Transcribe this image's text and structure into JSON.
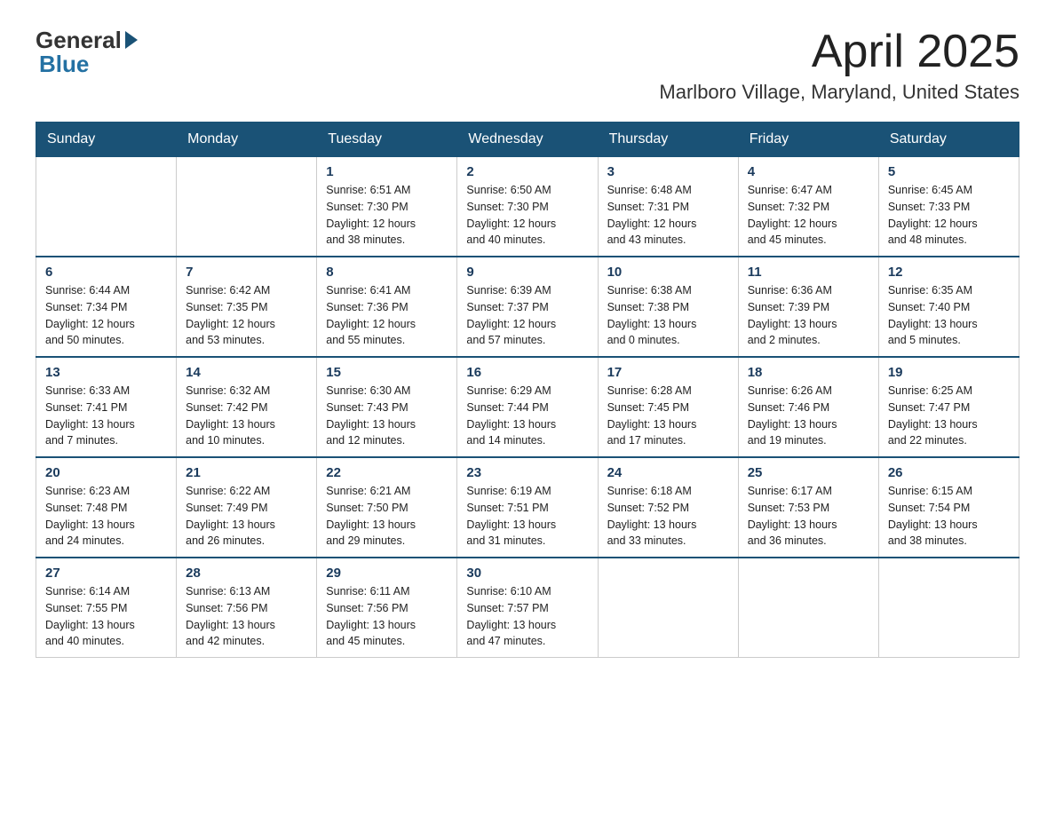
{
  "header": {
    "logo_general": "General",
    "logo_blue": "Blue",
    "month_year": "April 2025",
    "location": "Marlboro Village, Maryland, United States"
  },
  "weekdays": [
    "Sunday",
    "Monday",
    "Tuesday",
    "Wednesday",
    "Thursday",
    "Friday",
    "Saturday"
  ],
  "weeks": [
    [
      {
        "day": "",
        "info": ""
      },
      {
        "day": "",
        "info": ""
      },
      {
        "day": "1",
        "info": "Sunrise: 6:51 AM\nSunset: 7:30 PM\nDaylight: 12 hours\nand 38 minutes."
      },
      {
        "day": "2",
        "info": "Sunrise: 6:50 AM\nSunset: 7:30 PM\nDaylight: 12 hours\nand 40 minutes."
      },
      {
        "day": "3",
        "info": "Sunrise: 6:48 AM\nSunset: 7:31 PM\nDaylight: 12 hours\nand 43 minutes."
      },
      {
        "day": "4",
        "info": "Sunrise: 6:47 AM\nSunset: 7:32 PM\nDaylight: 12 hours\nand 45 minutes."
      },
      {
        "day": "5",
        "info": "Sunrise: 6:45 AM\nSunset: 7:33 PM\nDaylight: 12 hours\nand 48 minutes."
      }
    ],
    [
      {
        "day": "6",
        "info": "Sunrise: 6:44 AM\nSunset: 7:34 PM\nDaylight: 12 hours\nand 50 minutes."
      },
      {
        "day": "7",
        "info": "Sunrise: 6:42 AM\nSunset: 7:35 PM\nDaylight: 12 hours\nand 53 minutes."
      },
      {
        "day": "8",
        "info": "Sunrise: 6:41 AM\nSunset: 7:36 PM\nDaylight: 12 hours\nand 55 minutes."
      },
      {
        "day": "9",
        "info": "Sunrise: 6:39 AM\nSunset: 7:37 PM\nDaylight: 12 hours\nand 57 minutes."
      },
      {
        "day": "10",
        "info": "Sunrise: 6:38 AM\nSunset: 7:38 PM\nDaylight: 13 hours\nand 0 minutes."
      },
      {
        "day": "11",
        "info": "Sunrise: 6:36 AM\nSunset: 7:39 PM\nDaylight: 13 hours\nand 2 minutes."
      },
      {
        "day": "12",
        "info": "Sunrise: 6:35 AM\nSunset: 7:40 PM\nDaylight: 13 hours\nand 5 minutes."
      }
    ],
    [
      {
        "day": "13",
        "info": "Sunrise: 6:33 AM\nSunset: 7:41 PM\nDaylight: 13 hours\nand 7 minutes."
      },
      {
        "day": "14",
        "info": "Sunrise: 6:32 AM\nSunset: 7:42 PM\nDaylight: 13 hours\nand 10 minutes."
      },
      {
        "day": "15",
        "info": "Sunrise: 6:30 AM\nSunset: 7:43 PM\nDaylight: 13 hours\nand 12 minutes."
      },
      {
        "day": "16",
        "info": "Sunrise: 6:29 AM\nSunset: 7:44 PM\nDaylight: 13 hours\nand 14 minutes."
      },
      {
        "day": "17",
        "info": "Sunrise: 6:28 AM\nSunset: 7:45 PM\nDaylight: 13 hours\nand 17 minutes."
      },
      {
        "day": "18",
        "info": "Sunrise: 6:26 AM\nSunset: 7:46 PM\nDaylight: 13 hours\nand 19 minutes."
      },
      {
        "day": "19",
        "info": "Sunrise: 6:25 AM\nSunset: 7:47 PM\nDaylight: 13 hours\nand 22 minutes."
      }
    ],
    [
      {
        "day": "20",
        "info": "Sunrise: 6:23 AM\nSunset: 7:48 PM\nDaylight: 13 hours\nand 24 minutes."
      },
      {
        "day": "21",
        "info": "Sunrise: 6:22 AM\nSunset: 7:49 PM\nDaylight: 13 hours\nand 26 minutes."
      },
      {
        "day": "22",
        "info": "Sunrise: 6:21 AM\nSunset: 7:50 PM\nDaylight: 13 hours\nand 29 minutes."
      },
      {
        "day": "23",
        "info": "Sunrise: 6:19 AM\nSunset: 7:51 PM\nDaylight: 13 hours\nand 31 minutes."
      },
      {
        "day": "24",
        "info": "Sunrise: 6:18 AM\nSunset: 7:52 PM\nDaylight: 13 hours\nand 33 minutes."
      },
      {
        "day": "25",
        "info": "Sunrise: 6:17 AM\nSunset: 7:53 PM\nDaylight: 13 hours\nand 36 minutes."
      },
      {
        "day": "26",
        "info": "Sunrise: 6:15 AM\nSunset: 7:54 PM\nDaylight: 13 hours\nand 38 minutes."
      }
    ],
    [
      {
        "day": "27",
        "info": "Sunrise: 6:14 AM\nSunset: 7:55 PM\nDaylight: 13 hours\nand 40 minutes."
      },
      {
        "day": "28",
        "info": "Sunrise: 6:13 AM\nSunset: 7:56 PM\nDaylight: 13 hours\nand 42 minutes."
      },
      {
        "day": "29",
        "info": "Sunrise: 6:11 AM\nSunset: 7:56 PM\nDaylight: 13 hours\nand 45 minutes."
      },
      {
        "day": "30",
        "info": "Sunrise: 6:10 AM\nSunset: 7:57 PM\nDaylight: 13 hours\nand 47 minutes."
      },
      {
        "day": "",
        "info": ""
      },
      {
        "day": "",
        "info": ""
      },
      {
        "day": "",
        "info": ""
      }
    ]
  ]
}
